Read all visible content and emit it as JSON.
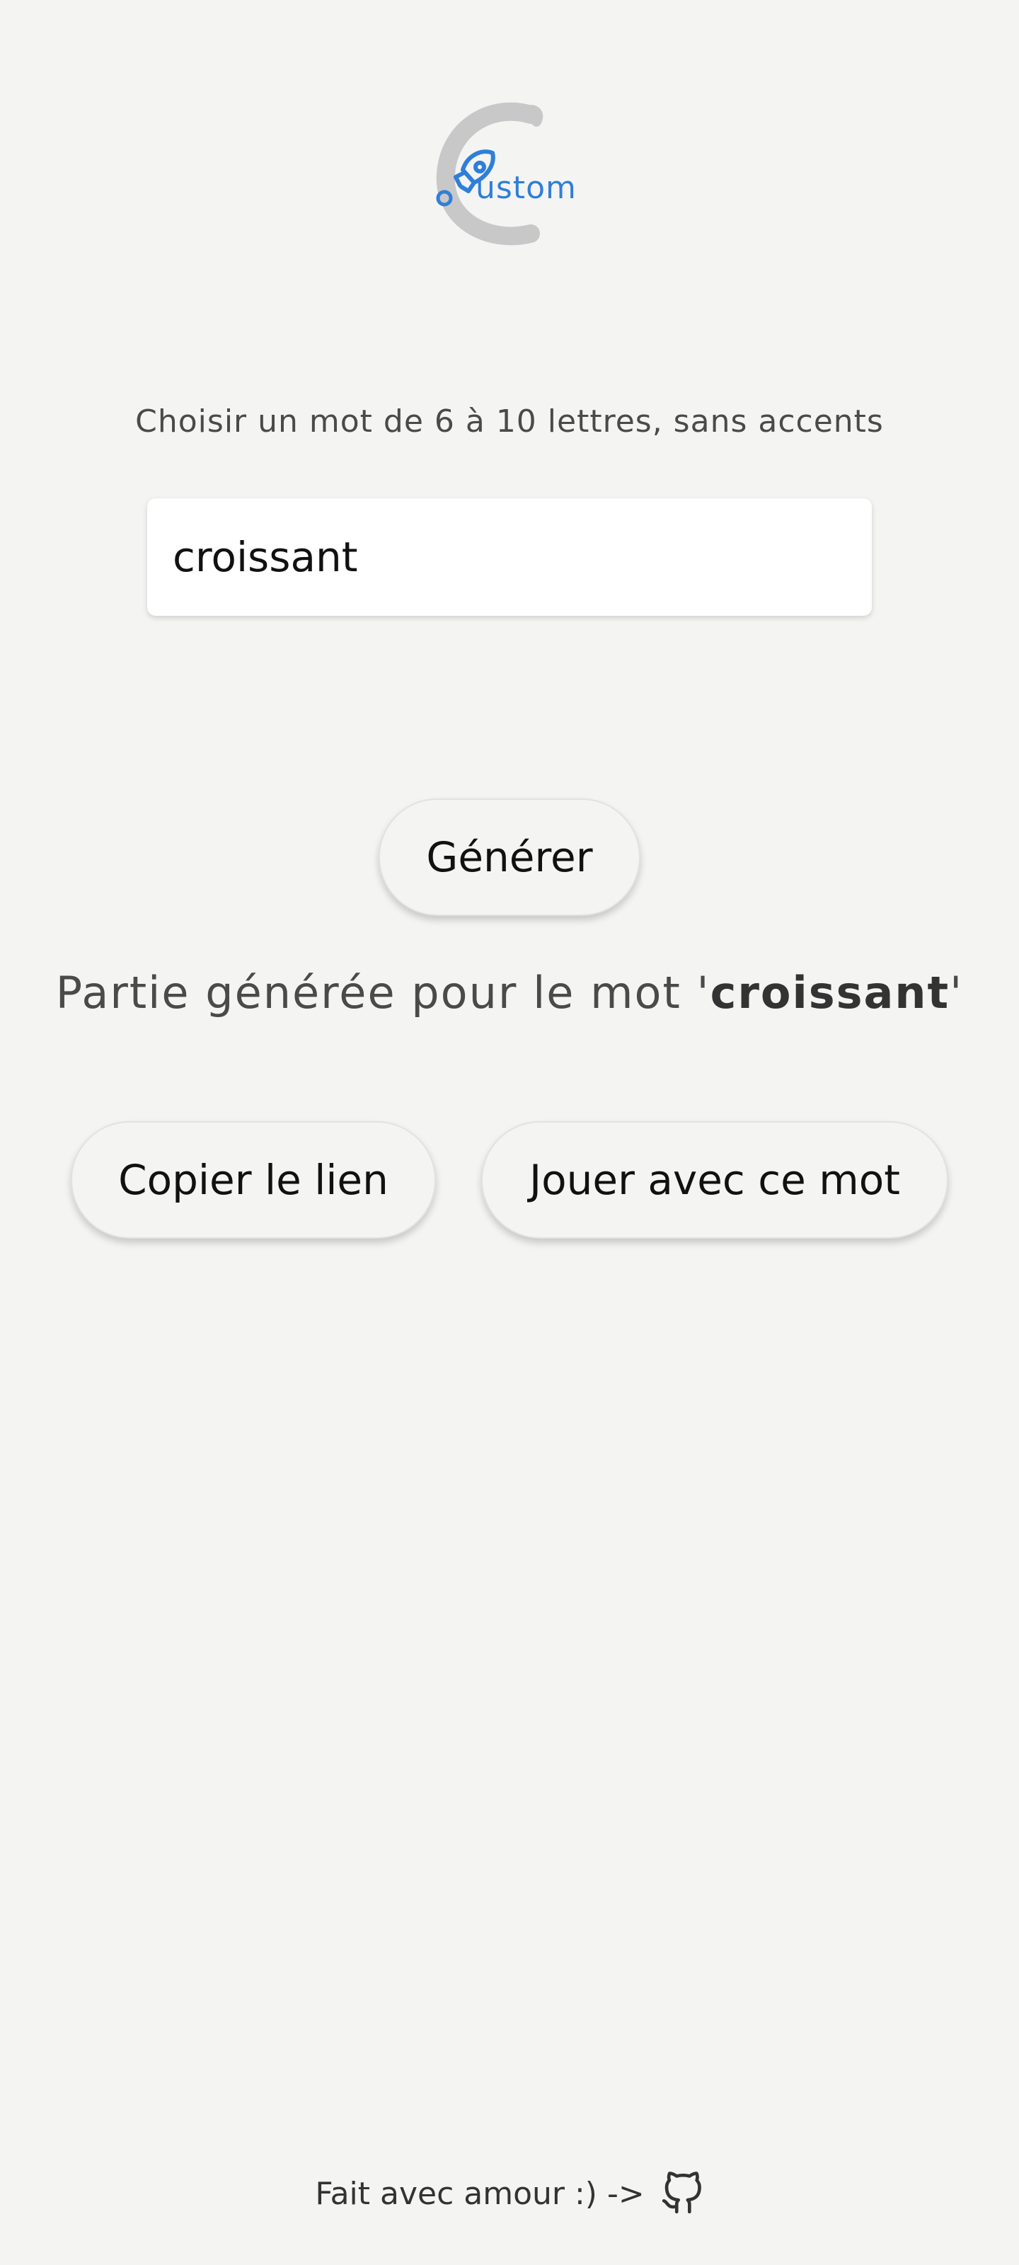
{
  "logo": {
    "text": "ustom",
    "accent_color": "#2f7fd8",
    "ring_color": "#c8c8c8",
    "icon": "rocket-icon"
  },
  "form": {
    "instruction": "Choisir un mot de 6 à 10 lettres, sans accents",
    "word_value": "croissant",
    "generate_label": "Générer"
  },
  "result": {
    "prefix": "Partie générée pour le mot ",
    "quote_open": "'",
    "word": "croissant",
    "quote_close": "'"
  },
  "actions": {
    "copy_label": "Copier le lien",
    "play_label": "Jouer avec ce mot"
  },
  "footer": {
    "text": "Fait avec amour :) ->",
    "icon": "github-icon"
  }
}
